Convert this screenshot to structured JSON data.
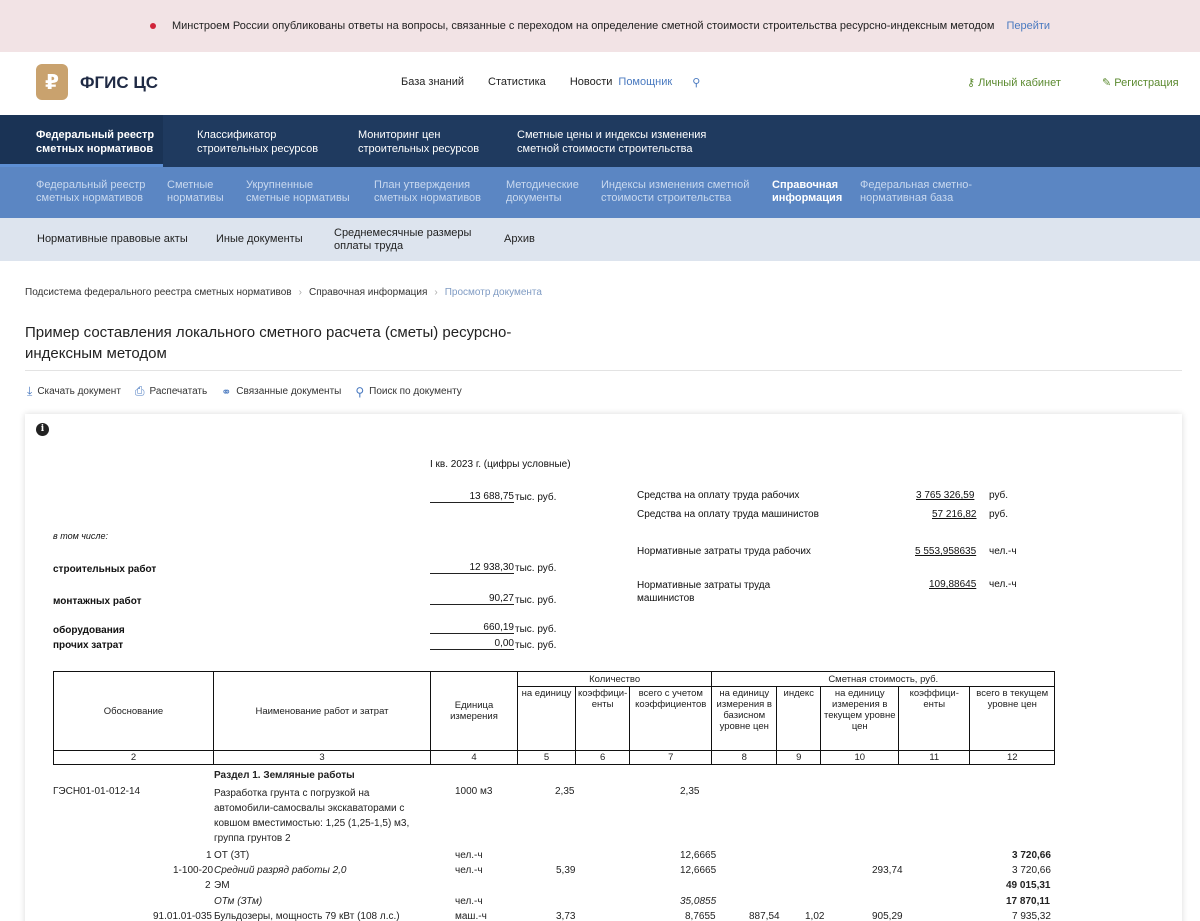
{
  "announcement": {
    "text": "Минстроем России опубликованы ответы на вопросы, связанные с переходом на определение сметной стоимости строительства ресурсно-индексным методом",
    "link": "Перейти"
  },
  "header": {
    "logo_text": "ФГИС ЦС",
    "nav": [
      "База знаний",
      "Статистика",
      "Новости",
      "Помощник"
    ],
    "cabinet": "Личный кабинет",
    "register": "Регистрация"
  },
  "nav1": [
    {
      "label": "Федеральный реестр\nсметных нормативов",
      "active": true
    },
    {
      "label": "Классификатор\nстроительных ресурсов",
      "active": false
    },
    {
      "label": "Мониторинг цен\nстроительных ресурсов",
      "active": false
    },
    {
      "label": "Сметные цены и индексы изменения\nсметной стоимости строительства",
      "active": false
    }
  ],
  "nav2": [
    {
      "label": "Федеральный реестр\nсметных нормативов",
      "active": false
    },
    {
      "label": "Сметные\nнормативы",
      "active": false
    },
    {
      "label": "Укрупненные\nсметные нормативы",
      "active": false
    },
    {
      "label": "План утверждения\nсметных нормативов",
      "active": false
    },
    {
      "label": "Методические\nдокументы",
      "active": false
    },
    {
      "label": "Индексы изменения сметной\nстоимости строительства",
      "active": false
    },
    {
      "label": "Справочная\nинформация",
      "active": true
    },
    {
      "label": "Федеральная сметно-\nнормативная база",
      "active": false
    }
  ],
  "nav3": [
    "Нормативные правовые акты",
    "Иные документы",
    "Среднемесячные размеры\nоплаты труда",
    "Архив"
  ],
  "breadcrumb": [
    "Подсистема федерального реестра сметных нормативов",
    "Справочная информация",
    "Просмотр документа"
  ],
  "title": "Пример составления локального сметного расчета (сметы) ресурсно-индексным методом",
  "toolbar": [
    "Скачать документ",
    "Распечатать",
    "Связанные документы",
    "Поиск по документу"
  ],
  "doc": {
    "period": "I кв. 2023 г. (цифры условные)",
    "total": "13 688,75",
    "unit_k": "тыс. руб.",
    "unit_r": "руб.",
    "unit_h": "чел.-ч",
    "incl": "в том числе:",
    "lines": [
      {
        "label": "строительных работ",
        "value": "12 938,30"
      },
      {
        "label": "монтажных работ",
        "value": "90,27"
      },
      {
        "label": "оборудования",
        "value": "660,19"
      },
      {
        "label": "прочих затрат",
        "value": "0,00"
      }
    ],
    "right": [
      {
        "label": "Средства на оплату труда рабочих",
        "value": "3 765 326,59",
        "unit": "руб."
      },
      {
        "label": "Средства на оплату труда машинистов",
        "value": "57 216,82",
        "unit": "руб."
      },
      {
        "label": "Нормативные затраты труда рабочих",
        "value": "5 553,958635",
        "unit": "чел.-ч"
      },
      {
        "label": "Нормативные затраты труда\nмашинистов",
        "value": "109,88645",
        "unit": "чел.-ч"
      }
    ]
  },
  "table": {
    "h_qty": "Количество",
    "h_cost": "Сметная стоимость, руб.",
    "h": [
      "Обоснование",
      "Наименование работ и затрат",
      "Единица измерения",
      "на единицу",
      "коэффици-енты",
      "всего с учетом коэффициентов",
      "на единицу измерения в базисном уровне цен",
      "индекс",
      "на единицу измерения в текущем уровне цен",
      "коэффици-енты",
      "всего в текущем уровне цен"
    ],
    "nums": [
      "2",
      "3",
      "4",
      "5",
      "6",
      "7",
      "8",
      "9",
      "10",
      "11",
      "12"
    ]
  },
  "rows": {
    "section": "Раздел 1. Земляные работы",
    "r1_code": "ГЭСН01-01-012-14",
    "r1_name": "Разработка грунта с погрузкой на автомобили-самосвалы экскаваторами с ковшом вместимостью: 1,25 (1,25-1,5) м3, группа грунтов 2",
    "r1_unit": "1000 м3",
    "r1_qty": "2,35",
    "r1_total": "2,35",
    "r2_code": "1",
    "r2_name": "ОТ (ЗТ)",
    "r2_unit": "чел.-ч",
    "r2_total": "12,6665",
    "r2_cost": "3 720,66",
    "r3_code": "1-100-20",
    "r3_name": "Средний разряд работы 2,0",
    "r3_unit": "чел.-ч",
    "r3_qty": "5,39",
    "r3_total": "12,6665",
    "r3_cur": "293,74",
    "r3_cost": "3 720,66",
    "r4_code": "2",
    "r4_name": "ЭМ",
    "r4_cost": "49 015,31",
    "r5_name": "ОТм (ЗТм)",
    "r5_unit": "чел.-ч",
    "r5_total": "35,0855",
    "r5_cost": "17 870,11",
    "r6_code": "91.01.01-035",
    "r6_name": "Бульдозеры, мощность 79 кВт (108 л.с.)",
    "r6_unit": "маш.-ч",
    "r6_qty": "3,73",
    "r6_total": "8,7655",
    "r6_base": "887,54",
    "r6_idx": "1,02",
    "r6_cur": "905,29",
    "r6_cost": "7 935,32"
  }
}
